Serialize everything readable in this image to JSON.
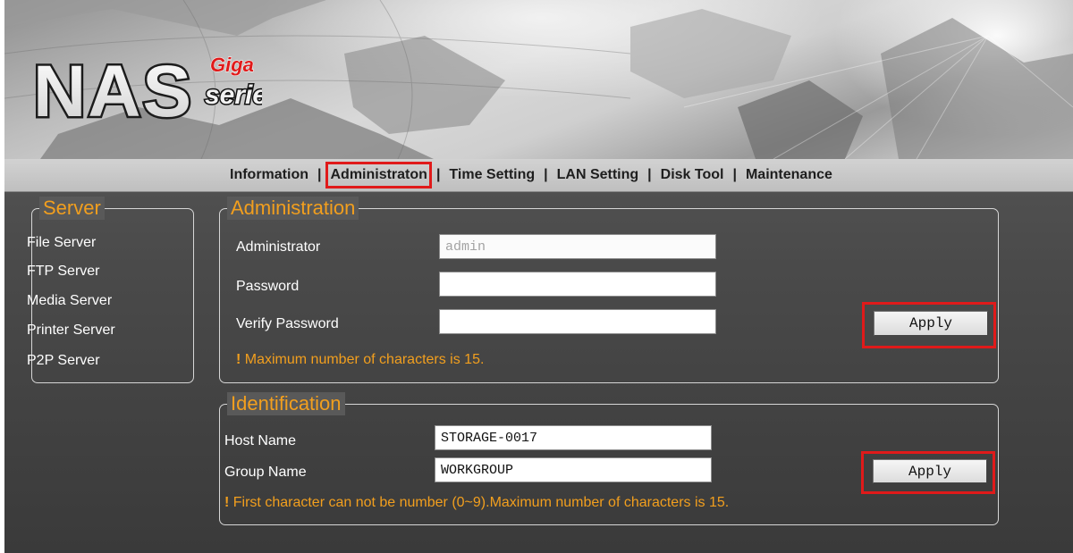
{
  "logo": {
    "brand": "NAS",
    "sub_top": "Giga",
    "sub_bottom": "series"
  },
  "menu": [
    {
      "label": "Information"
    },
    {
      "label": "Administraton",
      "active": true
    },
    {
      "label": "Time Setting"
    },
    {
      "label": "LAN Setting"
    },
    {
      "label": "Disk Tool"
    },
    {
      "label": "Maintenance"
    }
  ],
  "menu_separator": "|",
  "sidebar": {
    "title": "Server",
    "items": [
      {
        "label": "File Server"
      },
      {
        "label": "FTP Server"
      },
      {
        "label": "Media Server"
      },
      {
        "label": "Printer Server"
      },
      {
        "label": "P2P Server"
      }
    ]
  },
  "administration": {
    "title": "Administration",
    "administrator_label": "Administrator",
    "administrator_value": "admin",
    "password_label": "Password",
    "password_value": "",
    "verify_label": "Verify Password",
    "verify_value": "",
    "apply_label": "Apply",
    "note_mark": "!",
    "note_text": " Maximum number of characters is 15."
  },
  "identification": {
    "title": "Identification",
    "host_label": "Host Name",
    "host_value": "STORAGE-0017",
    "group_label": "Group Name",
    "group_value": "WORKGROUP",
    "apply_label": "Apply",
    "note_mark": "!",
    "note_text": " First character can not be number (0~9).Maximum number of characters is 15."
  },
  "colors": {
    "accent": "#f29f1e",
    "highlight": "#e01a1a",
    "panel_bg": "#595959"
  }
}
